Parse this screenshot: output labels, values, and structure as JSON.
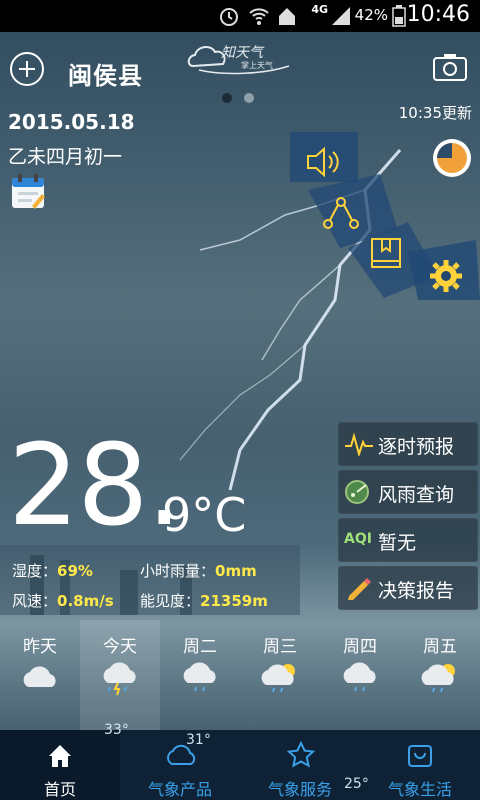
{
  "status_bar": {
    "time": "10:46",
    "battery": "42%",
    "network": "4G"
  },
  "header": {
    "city": "闽侯县",
    "logo_title": "知天气",
    "logo_subtitle": "掌上天气"
  },
  "date": {
    "solar": "2015.05.18",
    "lunar": "乙未四月初一"
  },
  "updated": "10:35更新",
  "menu": [
    {
      "label": "逐时预报",
      "icon": "pulse-icon"
    },
    {
      "label": "风雨查询",
      "icon": "radar-icon"
    },
    {
      "label": "暂无",
      "prefix": "AQI",
      "icon": "aqi-icon"
    },
    {
      "label": "决策报告",
      "icon": "pencil-icon"
    }
  ],
  "current": {
    "temp_int": "28.",
    "temp_dec": "9°C"
  },
  "stats": {
    "humidity_label": "湿度：",
    "humidity": "69%",
    "rain_label": "小时雨量：",
    "rain": "0mm",
    "wind_label": "风速：",
    "wind": "0.8m/s",
    "visibility_label": "能见度：",
    "visibility": "21359m"
  },
  "forecast": [
    {
      "day": "昨天",
      "icon": "cloudy-icon"
    },
    {
      "day": "今天",
      "icon": "thunder-rain-icon"
    },
    {
      "day": "周二",
      "icon": "cloud-rain-icon"
    },
    {
      "day": "周三",
      "icon": "sun-cloud-rain-icon"
    },
    {
      "day": "周四",
      "icon": "cloud-rain-icon"
    },
    {
      "day": "周五",
      "icon": "sun-cloud-rain-icon"
    }
  ],
  "temp_peek": [
    "31°",
    "25°",
    "33°"
  ],
  "tabs": [
    {
      "label": "首页",
      "icon": "home-icon"
    },
    {
      "label": "气象产品",
      "icon": "cloud-icon"
    },
    {
      "label": "气象服务",
      "icon": "star-icon"
    },
    {
      "label": "气象生活",
      "icon": "bag-icon"
    }
  ],
  "colors": {
    "accent_yellow": "#ffe84a",
    "tab_blue": "#3aa0e8"
  }
}
